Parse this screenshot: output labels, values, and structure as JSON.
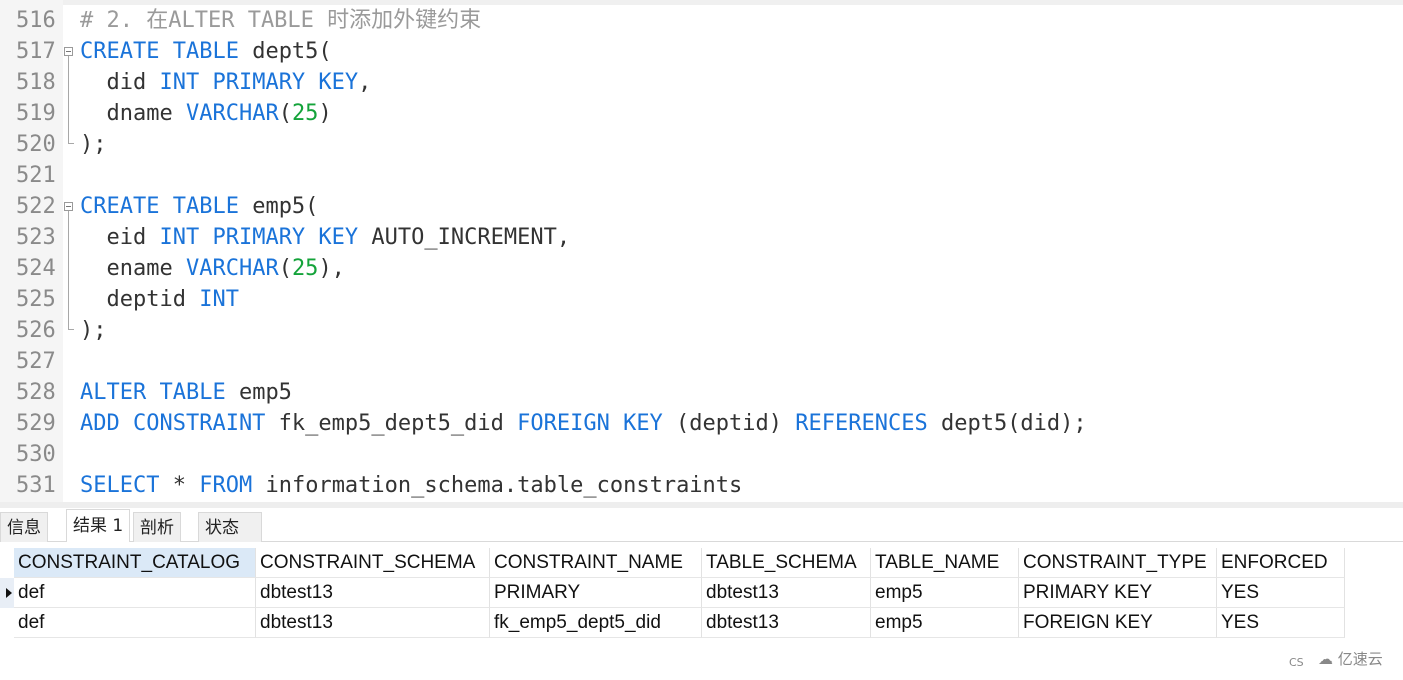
{
  "editor": {
    "lines": [
      {
        "num": "516",
        "tokens": [
          {
            "t": "# 2. 在ALTER TABLE 时添加外键约束",
            "c": "cmt"
          }
        ]
      },
      {
        "num": "517",
        "fold": "start",
        "tokens": [
          {
            "t": "CREATE TABLE",
            "c": "kw"
          },
          {
            "t": " dept5(",
            "c": ""
          }
        ]
      },
      {
        "num": "518",
        "tokens": [
          {
            "t": "  did ",
            "c": ""
          },
          {
            "t": "INT PRIMARY KEY",
            "c": "kw"
          },
          {
            "t": ",",
            "c": ""
          }
        ]
      },
      {
        "num": "519",
        "tokens": [
          {
            "t": "  dname ",
            "c": ""
          },
          {
            "t": "VARCHAR",
            "c": "kw"
          },
          {
            "t": "(",
            "c": ""
          },
          {
            "t": "25",
            "c": "num"
          },
          {
            "t": ")",
            "c": ""
          }
        ]
      },
      {
        "num": "520",
        "fold": "end",
        "tokens": [
          {
            "t": ");",
            "c": ""
          }
        ]
      },
      {
        "num": "521",
        "tokens": []
      },
      {
        "num": "522",
        "fold": "start",
        "tokens": [
          {
            "t": "CREATE TABLE",
            "c": "kw"
          },
          {
            "t": " emp5(",
            "c": ""
          }
        ]
      },
      {
        "num": "523",
        "tokens": [
          {
            "t": "  eid ",
            "c": ""
          },
          {
            "t": "INT PRIMARY KEY",
            "c": "kw"
          },
          {
            "t": " AUTO_INCREMENT,",
            "c": ""
          }
        ]
      },
      {
        "num": "524",
        "tokens": [
          {
            "t": "  ename ",
            "c": ""
          },
          {
            "t": "VARCHAR",
            "c": "kw"
          },
          {
            "t": "(",
            "c": ""
          },
          {
            "t": "25",
            "c": "num"
          },
          {
            "t": "),",
            "c": ""
          }
        ]
      },
      {
        "num": "525",
        "tokens": [
          {
            "t": "  deptid ",
            "c": ""
          },
          {
            "t": "INT",
            "c": "kw"
          }
        ]
      },
      {
        "num": "526",
        "fold": "end",
        "tokens": [
          {
            "t": ");",
            "c": ""
          }
        ]
      },
      {
        "num": "527",
        "tokens": []
      },
      {
        "num": "528",
        "tokens": [
          {
            "t": "ALTER TABLE",
            "c": "kw"
          },
          {
            "t": " emp5",
            "c": ""
          }
        ]
      },
      {
        "num": "529",
        "tokens": [
          {
            "t": "ADD CONSTRAINT",
            "c": "kw"
          },
          {
            "t": " fk_emp5_dept5_did ",
            "c": ""
          },
          {
            "t": "FOREIGN KEY",
            "c": "kw"
          },
          {
            "t": " (deptid) ",
            "c": ""
          },
          {
            "t": "REFERENCES",
            "c": "kw"
          },
          {
            "t": " dept5(did);",
            "c": ""
          }
        ]
      },
      {
        "num": "530",
        "tokens": []
      },
      {
        "num": "531",
        "tokens": [
          {
            "t": "SELECT",
            "c": "kw"
          },
          {
            "t": " * ",
            "c": ""
          },
          {
            "t": "FROM",
            "c": "kw"
          },
          {
            "t": " information_schema.table_constraints",
            "c": ""
          }
        ]
      }
    ]
  },
  "result_tabs": [
    {
      "label": "信息",
      "active": false
    },
    {
      "label": "结果 1",
      "active": true
    },
    {
      "label": "剖析",
      "active": false
    },
    {
      "label": "状态",
      "active": false
    }
  ],
  "result_grid": {
    "columns": [
      "CONSTRAINT_CATALOG",
      "CONSTRAINT_SCHEMA",
      "CONSTRAINT_NAME",
      "TABLE_SCHEMA",
      "TABLE_NAME",
      "CONSTRAINT_TYPE",
      "ENFORCED"
    ],
    "rows": [
      [
        "def",
        "dbtest13",
        "PRIMARY",
        "dbtest13",
        "emp5",
        "PRIMARY KEY",
        "YES"
      ],
      [
        "def",
        "dbtest13",
        "fk_emp5_dept5_did",
        "dbtest13",
        "emp5",
        "FOREIGN KEY",
        "YES"
      ]
    ],
    "current_row": 0,
    "selected_column": 0
  },
  "watermark": {
    "left_text": "CS",
    "brand_text": "亿速云",
    "brand_icon": "cloud-logo-icon"
  },
  "colors": {
    "keyword": "#1a73d9",
    "number": "#14a33a",
    "comment": "#9a9a9a",
    "header_selected": "#dbe9f7"
  }
}
